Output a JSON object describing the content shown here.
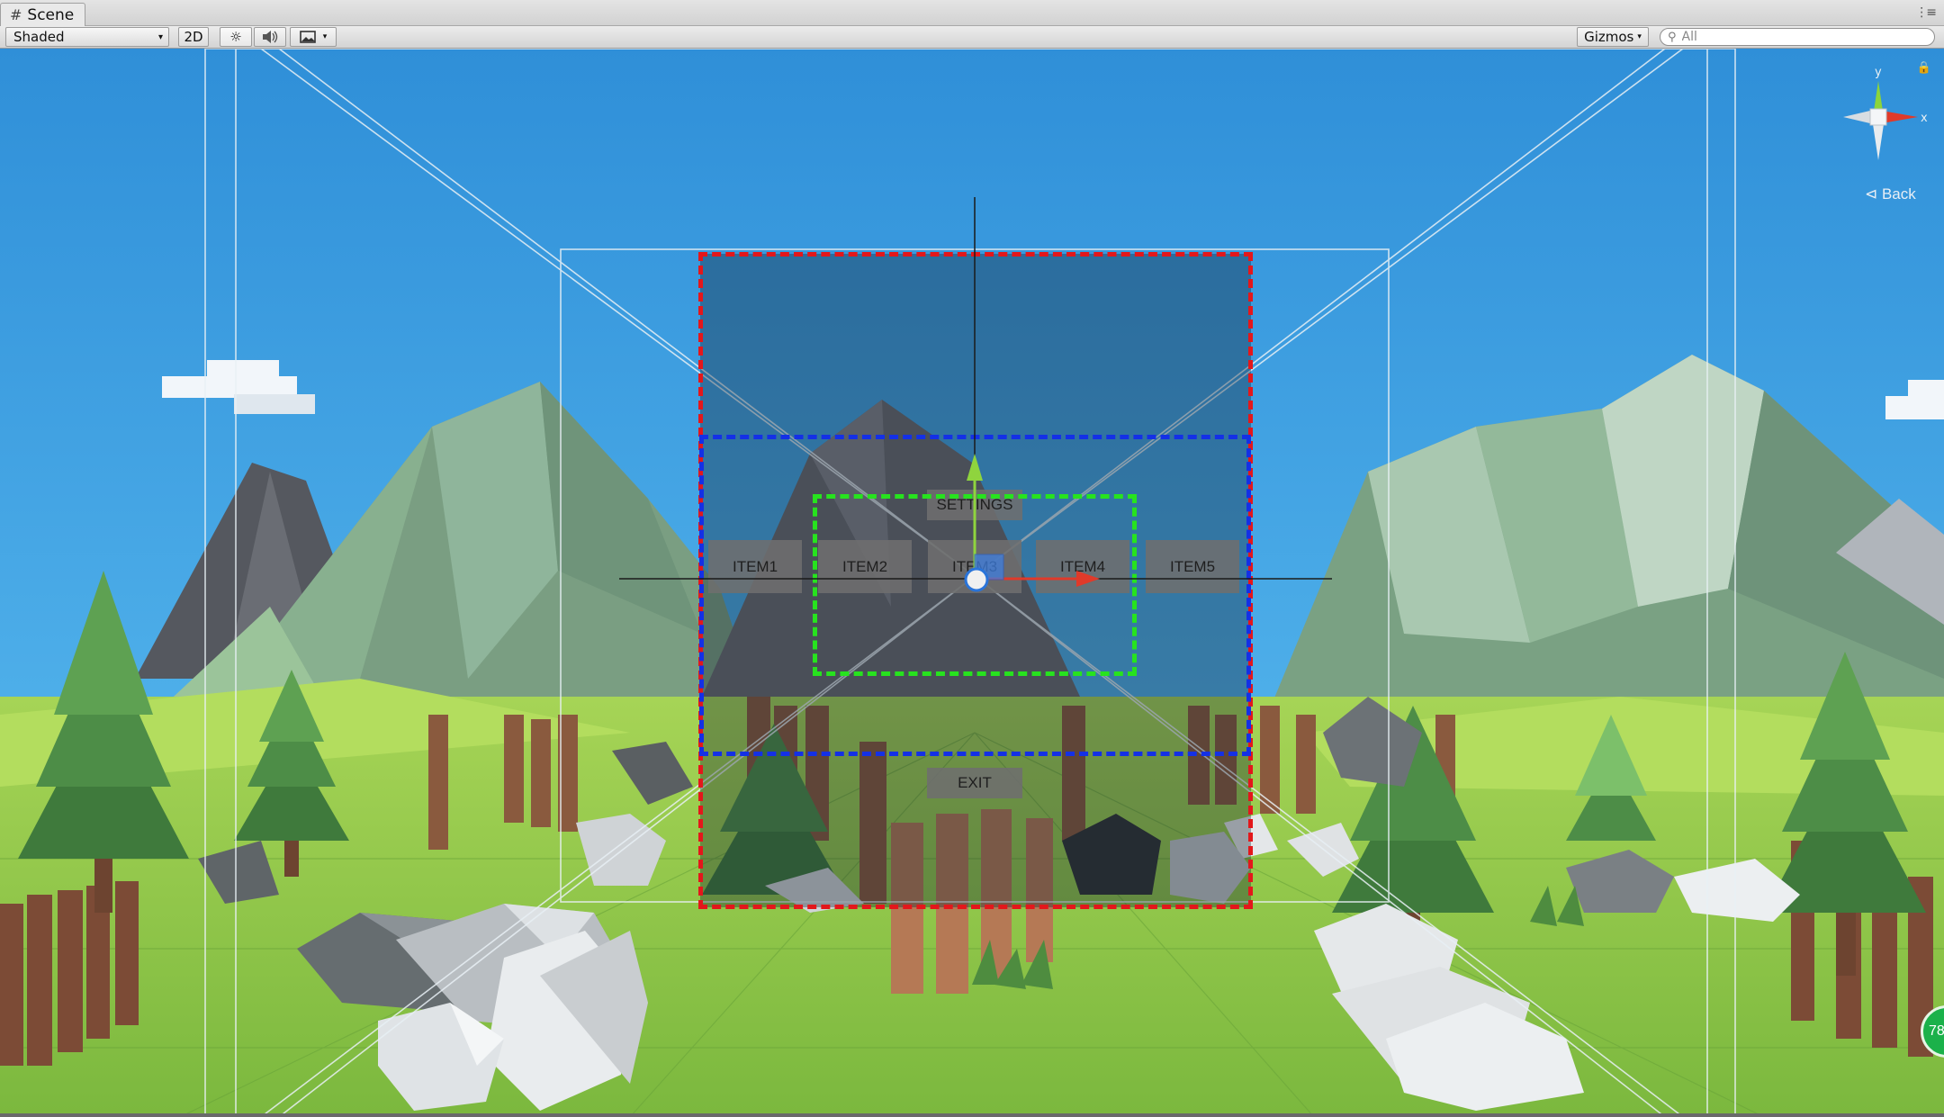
{
  "tab": {
    "title": "Scene",
    "menu": "⋮≡"
  },
  "toolbar": {
    "shading": "Shaded",
    "mode_2d": "2D",
    "light_glyph": "☼",
    "audio_glyph": "🔉",
    "fx_glyph": "▣",
    "dropdown_arrow": "▾",
    "gizmos": "Gizmos",
    "search_placeholder": "All"
  },
  "menu": {
    "settings": "SETTINGS",
    "items": [
      "ITEM1",
      "ITEM2",
      "ITEM3",
      "ITEM4",
      "ITEM5"
    ],
    "exit": "EXIT"
  },
  "gizmo": {
    "y_label": "y",
    "x_label": "x",
    "back": "⊲ Back"
  },
  "badge": {
    "value": "78"
  },
  "colors": {
    "sky": "#3a9ee0",
    "ground": "#7dbe3e",
    "red_bounds": "#e3171b",
    "blue_bounds": "#1430e6",
    "green_bounds": "#27e31e"
  }
}
